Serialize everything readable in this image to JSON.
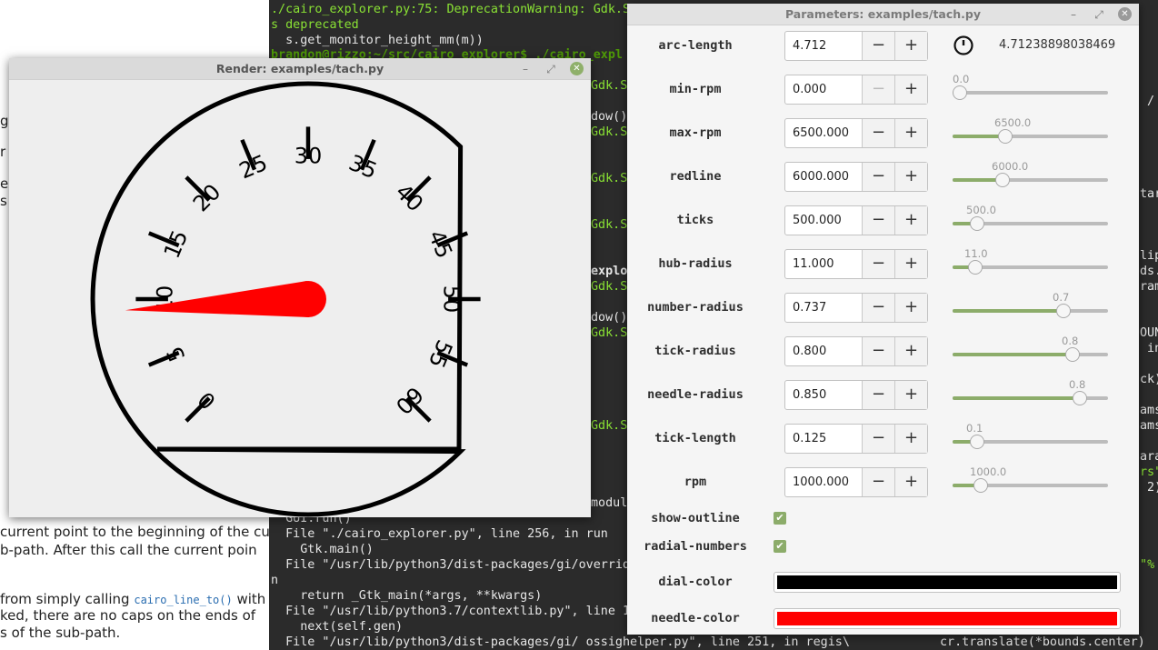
{
  "background_doc": {
    "lines": [
      {
        "text": "current point to the beginning of the cu"
      },
      {
        "text": "b-path. After this call the current poin"
      },
      {
        "text": "from simply calling "
      },
      {
        "code": "cairo_line_to()"
      },
      {
        "text": " with"
      },
      {
        "text": "ked, there are no caps on the ends of"
      },
      {
        "text": "s of the sub-path."
      },
      {
        "text": "g"
      },
      {
        "text": "r"
      },
      {
        "text": "e"
      },
      {
        "text": "s"
      }
    ]
  },
  "terminal": {
    "lines": [
      "./cairo_explorer.py:75: DeprecationWarning: Gdk.S",
      "s deprecated",
      "  s.get_monitor_height_mm(m))",
      "brandon@rizzo:~/src/cairo_explorer$ ./cairo_expl",
      "Gdk.S",
      "dow()",
      "Gdk.S",
      "Gdk.S",
      "Gdk.S",
      "explo",
      "Gdk.S",
      "dow()",
      "Gdk.S",
      "Gdk.S",
      "modul",
      "  GUI.run()",
      "  File \"./cairo_explorer.py\", line 256, in run",
      "    Gtk.main()",
      "  File \"/usr/lib/python3/dist-packages/gi/overrid",
      "n",
      "    return _Gtk_main(*args, **kwargs)",
      "  File \"/usr/lib/python3.7/contextlib.py\", line 1",
      "    next(self.gen)",
      "  File \"/usr/lib/python3/dist-packages/gi/ ossighelper.py\", line 251, in regis\\",
      "cr.translate(*bounds.center)",
      "/",
      "tar",
      "lip",
      "ds.",
      "ram",
      "OUN",
      " in",
      "ck)",
      "ams",
      "ams",
      "ara",
      "rs\"",
      " 2)",
      "(\"%"
    ]
  },
  "render_window": {
    "title": "Render: examples/tach.py",
    "min_icon": "minimize-icon",
    "max_icon": "maximize-icon",
    "close_icon": "close-icon"
  },
  "params_window": {
    "title": "Parameters: examples/tach.py",
    "arc_display": "4.71238898038469",
    "params": [
      {
        "key": "arc-length",
        "value": "4.712",
        "minus_disabled": false,
        "slider": null
      },
      {
        "key": "min-rpm",
        "value": "0.000",
        "minus_disabled": true,
        "slider": {
          "label": "0.0",
          "fraction": 0.0
        }
      },
      {
        "key": "max-rpm",
        "value": "6500.000",
        "minus_disabled": false,
        "slider": {
          "label": "6500.0",
          "fraction": 0.325
        }
      },
      {
        "key": "redline",
        "value": "6000.000",
        "minus_disabled": false,
        "slider": {
          "label": "6000.0",
          "fraction": 0.3
        }
      },
      {
        "key": "ticks",
        "value": "500.000",
        "minus_disabled": false,
        "slider": {
          "label": "500.0",
          "fraction": 0.12
        }
      },
      {
        "key": "hub-radius",
        "value": "11.000",
        "minus_disabled": false,
        "slider": {
          "label": "11.0",
          "fraction": 0.11
        }
      },
      {
        "key": "number-radius",
        "value": "0.737",
        "minus_disabled": false,
        "slider": {
          "label": "0.7",
          "fraction": 0.737
        }
      },
      {
        "key": "tick-radius",
        "value": "0.800",
        "minus_disabled": false,
        "slider": {
          "label": "0.8",
          "fraction": 0.8
        }
      },
      {
        "key": "needle-radius",
        "value": "0.850",
        "minus_disabled": false,
        "slider": {
          "label": "0.8",
          "fraction": 0.85
        }
      },
      {
        "key": "tick-length",
        "value": "0.125",
        "minus_disabled": false,
        "slider": {
          "label": "0.1",
          "fraction": 0.125
        }
      },
      {
        "key": "rpm",
        "value": "1000.000",
        "minus_disabled": false,
        "slider": {
          "label": "1000.0",
          "fraction": 0.15
        }
      }
    ],
    "checks": [
      {
        "key": "show-outline",
        "checked": true
      },
      {
        "key": "radial-numbers",
        "checked": true
      }
    ],
    "colors": [
      {
        "key": "dial-color",
        "value": "#000000"
      },
      {
        "key": "needle-color",
        "value": "#ff0000"
      }
    ]
  },
  "gauge": {
    "tick_labels": [
      "0",
      "5",
      "10",
      "15",
      "20",
      "25",
      "30",
      "35",
      "40",
      "45",
      "50",
      "55",
      "60"
    ],
    "needle_color": "#ff0000",
    "dial_color": "#000000",
    "rpm": 1000,
    "max_rpm": 6500
  }
}
